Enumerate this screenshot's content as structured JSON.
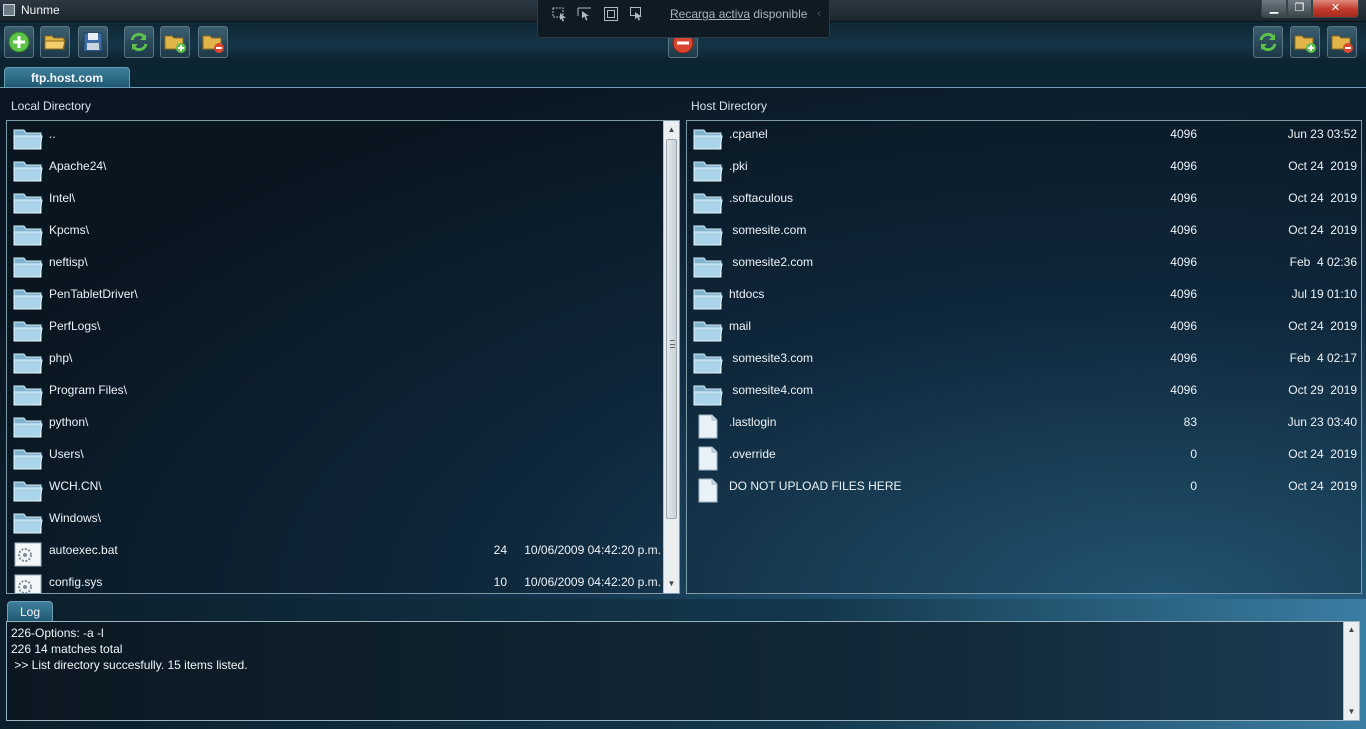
{
  "window": {
    "title": "Nunme",
    "controls": {
      "minimize": "▁",
      "maximize": "❐",
      "close": "✕"
    }
  },
  "reload_banner": {
    "link_text": "Recarga activa",
    "text": " disponible",
    "icons": [
      "select-element-icon",
      "pointer-icon",
      "layout-icon",
      "track-icon"
    ]
  },
  "toolbar": {
    "left_buttons": [
      "new-connection-icon",
      "open-folder-icon",
      "save-icon",
      "refresh-icon",
      "new-folder-icon",
      "delete-folder-icon"
    ],
    "center_button": "disconnect-icon",
    "right_buttons": [
      "refresh-icon",
      "new-folder-icon",
      "delete-folder-icon"
    ]
  },
  "tab": {
    "label": "ftp.host.com"
  },
  "local": {
    "label": "Local Directory",
    "items": [
      {
        "type": "folder",
        "name": "..",
        "size": "",
        "date": ""
      },
      {
        "type": "folder",
        "name": "Apache24\\",
        "size": "",
        "date": ""
      },
      {
        "type": "folder",
        "name": "Intel\\",
        "size": "",
        "date": ""
      },
      {
        "type": "folder",
        "name": "Kpcms\\",
        "size": "",
        "date": ""
      },
      {
        "type": "folder",
        "name": "neftisp\\",
        "size": "",
        "date": ""
      },
      {
        "type": "folder",
        "name": "PenTabletDriver\\",
        "size": "",
        "date": ""
      },
      {
        "type": "folder",
        "name": "PerfLogs\\",
        "size": "",
        "date": ""
      },
      {
        "type": "folder",
        "name": "php\\",
        "size": "",
        "date": ""
      },
      {
        "type": "folder",
        "name": "Program Files\\",
        "size": "",
        "date": ""
      },
      {
        "type": "folder",
        "name": "python\\",
        "size": "",
        "date": ""
      },
      {
        "type": "folder",
        "name": "Users\\",
        "size": "",
        "date": ""
      },
      {
        "type": "folder",
        "name": "WCH.CN\\",
        "size": "",
        "date": ""
      },
      {
        "type": "folder",
        "name": "Windows\\",
        "size": "",
        "date": ""
      },
      {
        "type": "system-file",
        "name": "autoexec.bat",
        "size": "24",
        "date": "10/06/2009 04:42:20 p.m."
      },
      {
        "type": "system-file",
        "name": "config.sys",
        "size": "10",
        "date": "10/06/2009 04:42:20 p.m."
      }
    ]
  },
  "host": {
    "label": "Host Directory",
    "items": [
      {
        "type": "folder",
        "name": ".cpanel",
        "size": "4096",
        "date": "Jun 23 03:52"
      },
      {
        "type": "folder",
        "name": ".pki",
        "size": "4096",
        "date": "Oct 24  2019"
      },
      {
        "type": "folder",
        "name": ".softaculous",
        "size": "4096",
        "date": "Oct 24  2019"
      },
      {
        "type": "folder",
        "name": " somesite.com",
        "size": "4096",
        "date": "Oct 24  2019"
      },
      {
        "type": "folder",
        "name": " somesite2.com",
        "size": "4096",
        "date": "Feb  4 02:36"
      },
      {
        "type": "folder",
        "name": "htdocs",
        "size": "4096",
        "date": "Jul 19 01:10"
      },
      {
        "type": "folder",
        "name": "mail",
        "size": "4096",
        "date": "Oct 24  2019"
      },
      {
        "type": "folder",
        "name": " somesite3.com",
        "size": "4096",
        "date": "Feb  4 02:17"
      },
      {
        "type": "folder",
        "name": " somesite4.com",
        "size": "4096",
        "date": "Oct 29  2019"
      },
      {
        "type": "file",
        "name": ".lastlogin",
        "size": "83",
        "date": "Jun 23 03:40"
      },
      {
        "type": "file",
        "name": ".override",
        "size": "0",
        "date": "Oct 24  2019"
      },
      {
        "type": "file",
        "name": "DO NOT UPLOAD FILES HERE",
        "size": "0",
        "date": "Oct 24  2019"
      }
    ]
  },
  "log": {
    "tab_label": "Log",
    "lines": [
      "226-Options: -a -l",
      "226 14 matches total",
      " >> List directory succesfully. 15 items listed."
    ]
  },
  "colors": {
    "accent": "#3e7f9c",
    "panel_border": "#7f9aa8",
    "folder": "#a9d4ea"
  }
}
